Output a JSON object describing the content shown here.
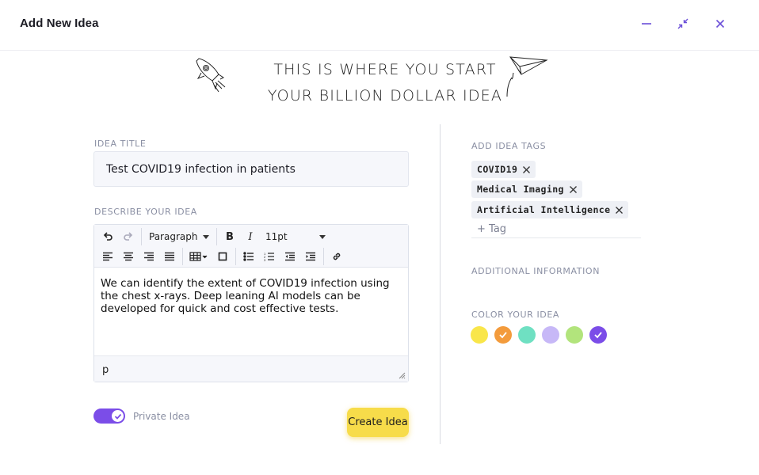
{
  "header": {
    "title": "Add New Idea"
  },
  "hero": {
    "line1": "THIS IS WHERE YOU START",
    "line2": "YOUR BILLION DOLLAR IDEA"
  },
  "form": {
    "title_label": "IDEA TITLE",
    "title_value": "Test COVID19 infection in patients",
    "describe_label": "DESCRIBE YOUR IDEA",
    "editor": {
      "block_format": "Paragraph",
      "font_size": "11pt",
      "body_text": "We can identify the extent of COVID19 infection using the chest x-rays. Deep leaning AI models can be developed for quick and cost effective tests.",
      "status_path": "p"
    },
    "private_label": "Private Idea",
    "private_on": true,
    "create_label": "Create Idea"
  },
  "sidebar": {
    "tags_label": "ADD IDEA TAGS",
    "tags": [
      "COVID19",
      "Medical Imaging",
      "Artificial Intelligence"
    ],
    "tag_placeholder": "+ Tag",
    "additional_label": "ADDITIONAL INFORMATION",
    "color_label": "COLOR YOUR IDEA",
    "colors": [
      {
        "hex": "#f9e64a",
        "checked": false
      },
      {
        "hex": "#f39b3c",
        "checked": true
      },
      {
        "hex": "#6fe0c2",
        "checked": false
      },
      {
        "hex": "#c7b8f7",
        "checked": false
      },
      {
        "hex": "#b2e47c",
        "checked": false
      },
      {
        "hex": "#7b4de8",
        "checked": true
      }
    ]
  },
  "colors": {
    "accent": "#7b4de8",
    "button": "#f7dc4a"
  }
}
